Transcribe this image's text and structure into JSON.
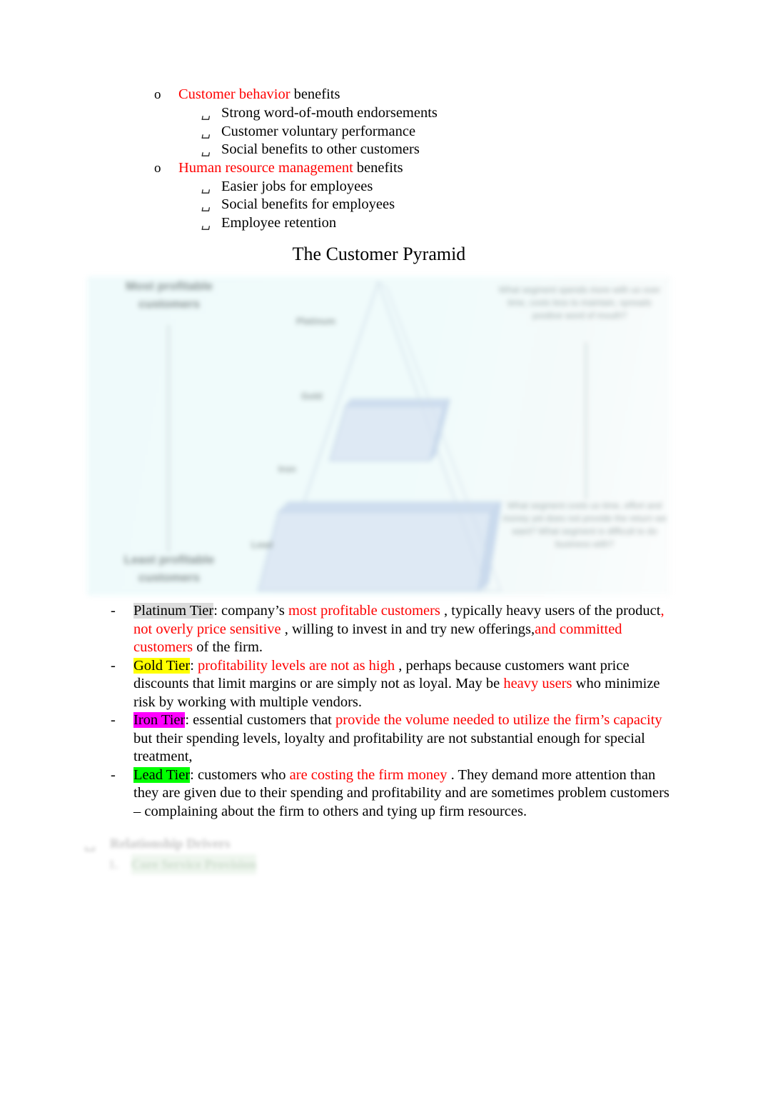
{
  "outline": [
    {
      "marker": "o",
      "heading_red": "Customer behavior",
      "heading_rest": "benefits",
      "subitems": [
        {
          "marker": "␣",
          "text": "Strong word-of-mouth endorsements"
        },
        {
          "marker": "␣",
          "text": "Customer voluntary performance"
        },
        {
          "marker": "␣",
          "text": "Social benefits to other customers"
        }
      ]
    },
    {
      "marker": "o",
      "heading_red": "Human resource management",
      "heading_rest": "benefits",
      "subitems": [
        {
          "marker": "␣",
          "text": "Easier jobs for employees"
        },
        {
          "marker": "␣",
          "text": "Social benefits for employees"
        },
        {
          "marker": "␣",
          "text": "Employee retention"
        }
      ]
    }
  ],
  "figure_title": "The Customer Pyramid",
  "figure": {
    "left_top_label": "Most profitable customers",
    "left_bottom_label": "Least profitable customers",
    "right_top_label": "What segment spends more with us over time, costs less to maintain, spreads positive word of mouth?",
    "right_bottom_label": "What segment costs us time, effort and money yet does not provide the return we want? What segment is difficult to do business with?",
    "tiers": [
      {
        "name": "Platinum"
      },
      {
        "name": "Gold"
      },
      {
        "name": "Iron"
      },
      {
        "name": "Lead"
      }
    ],
    "bg_color": "#effafa",
    "tier_fill_color": "#dce8f4"
  },
  "notes": [
    {
      "dash": "-",
      "label": "Platinum Tier",
      "label_highlight": "gray",
      "segments": [
        {
          "text": ": company’s ",
          "color": "black"
        },
        {
          "text": "most profitable customers",
          "color": "red"
        },
        {
          "text": " , typically heavy users of the product",
          "color": "black"
        },
        {
          "text": ", not overly price sensitive",
          "color": "red"
        },
        {
          "text": " , willing to invest in and try new offerings,",
          "color": "black"
        },
        {
          "text": "and committed customers",
          "color": "red"
        },
        {
          "text": " of the firm.",
          "color": "black"
        }
      ]
    },
    {
      "dash": "-",
      "label": "Gold Tier",
      "label_highlight": "yellow",
      "segments": [
        {
          "text": ": ",
          "color": "black"
        },
        {
          "text": "profitability levels are not as high",
          "color": "red"
        },
        {
          "text": " , perhaps because customers want price discounts that limit margins or are simply not as loyal. May be ",
          "color": "black"
        },
        {
          "text": "heavy users",
          "color": "red"
        },
        {
          "text": " who minimize risk by working with multiple vendors.",
          "color": "black"
        }
      ]
    },
    {
      "dash": "-",
      "label": "Iron Tier",
      "label_highlight": "pink",
      "segments": [
        {
          "text": ": essential customers that ",
          "color": "black"
        },
        {
          "text": " provide the volume needed to utilize the firm’s capacity",
          "color": "red"
        },
        {
          "text": " but their spending levels, loyalty and profitability are not substantial enough for special treatment,",
          "color": "black"
        }
      ]
    },
    {
      "dash": "-",
      "label": "Lead Tier",
      "label_highlight": "green",
      "segments": [
        {
          "text": ": customers who ",
          "color": "black"
        },
        {
          "text": "are costing the firm money",
          "color": "red"
        },
        {
          "text": " . They demand more attention than they are given due to their spending and profitability and are sometimes problem customers – complaining about the firm to others and tying up firm resources.",
          "color": "black"
        }
      ]
    }
  ],
  "faded_block": {
    "line1_marker": "␣",
    "line1_text": "Relationship Drivers",
    "line2_marker": "1.",
    "line2_text": "Core Service Provision"
  }
}
